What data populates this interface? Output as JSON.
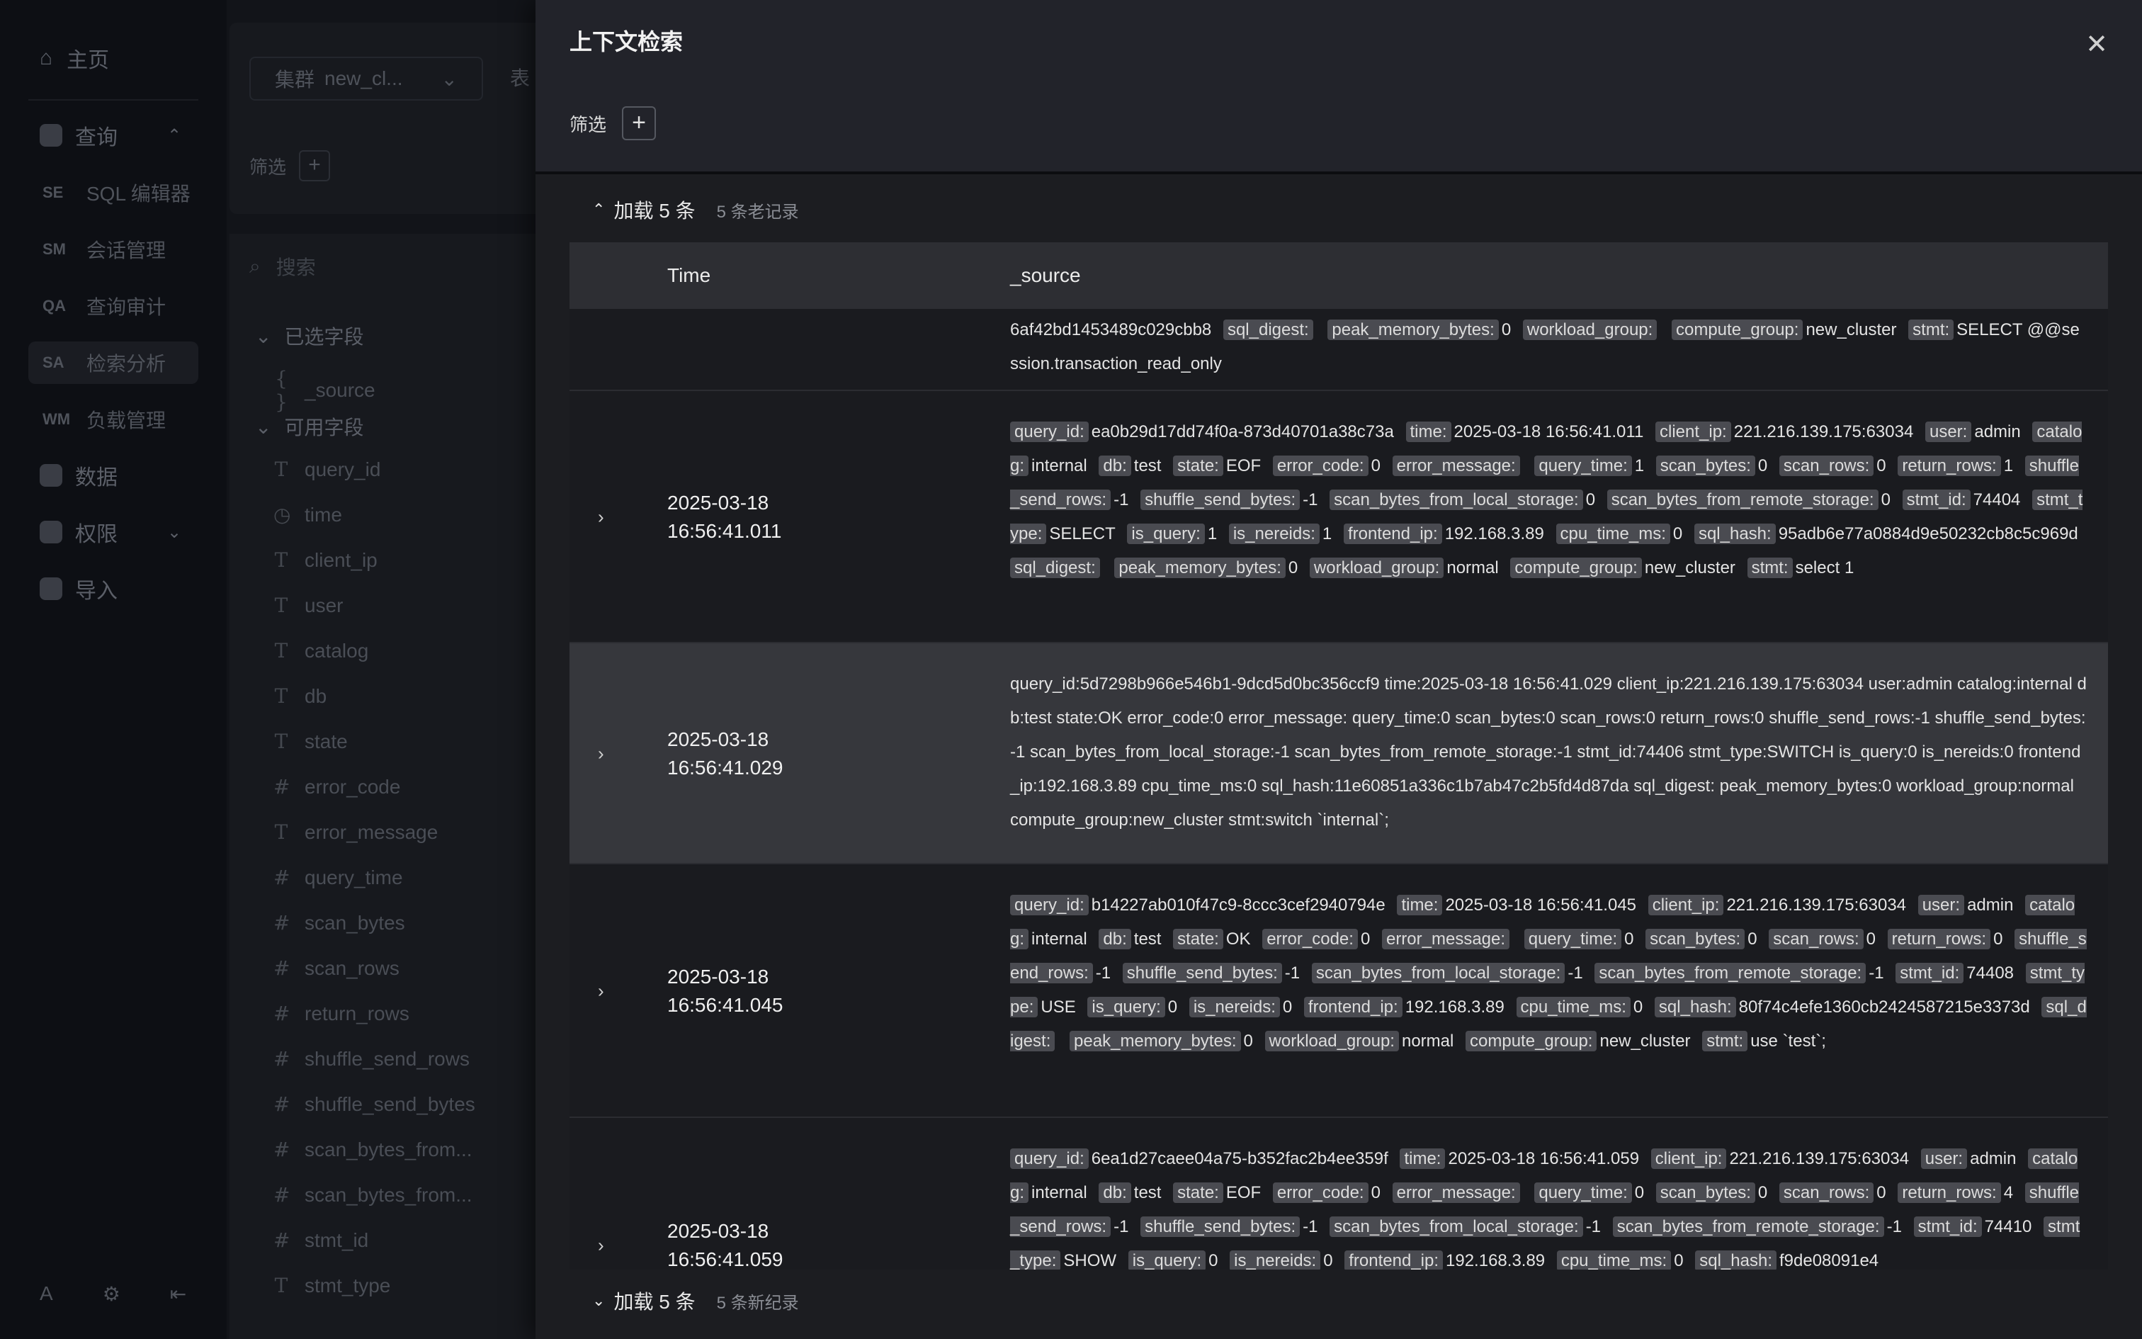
{
  "sidebar": {
    "home": "主页",
    "query_group": "查询",
    "items": [
      {
        "abbr": "SE",
        "label": "SQL 编辑器"
      },
      {
        "abbr": "SM",
        "label": "会话管理"
      },
      {
        "abbr": "QA",
        "label": "查询审计"
      },
      {
        "abbr": "SA",
        "label": "检索分析"
      },
      {
        "abbr": "WM",
        "label": "负载管理"
      }
    ],
    "data": "数据",
    "permissions": "权限",
    "import": "导入",
    "footer_avatar": "A"
  },
  "background": {
    "cluster_label": "集群",
    "cluster_value": "new_cl...",
    "table_label": "表",
    "filter_label": "筛选",
    "search_placeholder": "搜索",
    "selected_fields_label": "已选字段",
    "selected_fields": [
      "_source"
    ],
    "available_fields_label": "可用字段",
    "available_fields": [
      {
        "type": "T",
        "name": "query_id"
      },
      {
        "type": "◷",
        "name": "time"
      },
      {
        "type": "T",
        "name": "client_ip"
      },
      {
        "type": "T",
        "name": "user"
      },
      {
        "type": "T",
        "name": "catalog"
      },
      {
        "type": "T",
        "name": "db"
      },
      {
        "type": "T",
        "name": "state"
      },
      {
        "type": "#",
        "name": "error_code"
      },
      {
        "type": "T",
        "name": "error_message"
      },
      {
        "type": "#",
        "name": "query_time"
      },
      {
        "type": "#",
        "name": "scan_bytes"
      },
      {
        "type": "#",
        "name": "scan_rows"
      },
      {
        "type": "#",
        "name": "return_rows"
      },
      {
        "type": "#",
        "name": "shuffle_send_rows"
      },
      {
        "type": "#",
        "name": "shuffle_send_bytes"
      },
      {
        "type": "#",
        "name": "scan_bytes_from..."
      },
      {
        "type": "#",
        "name": "scan_bytes_from..."
      },
      {
        "type": "#",
        "name": "stmt_id"
      },
      {
        "type": "T",
        "name": "stmt_type"
      }
    ]
  },
  "drawer": {
    "title": "上下文检索",
    "filter_label": "筛选",
    "load_older_label": "加载 5 条",
    "older_count": "5 条老记录",
    "load_newer_label": "加载 5 条",
    "newer_count": "5 条新纪录",
    "columns": {
      "time": "Time",
      "source": "_source"
    }
  },
  "rows": [
    {
      "date": "",
      "clock": "",
      "plain": false,
      "partial": true,
      "fields": [
        {
          "k": "",
          "v": "6af42bd1453489c029cbb8"
        },
        {
          "k": "sql_digest:",
          "v": ""
        },
        {
          "k": "peak_memory_bytes:",
          "v": "0"
        },
        {
          "k": "workload_group:",
          "v": ""
        },
        {
          "k": "compute_group:",
          "v": "new_cluster"
        },
        {
          "k": "stmt:",
          "v": "SELECT @@session.transaction_read_only"
        }
      ]
    },
    {
      "date": "2025-03-18",
      "clock": "16:56:41.011",
      "plain": false,
      "fields": [
        {
          "k": "query_id:",
          "v": "ea0b29d17dd74f0a-873d40701a38c73a"
        },
        {
          "k": "time:",
          "v": "2025-03-18 16:56:41.011"
        },
        {
          "k": "client_ip:",
          "v": "221.216.139.175:63034"
        },
        {
          "k": "user:",
          "v": "admin"
        },
        {
          "k": "catalog:",
          "v": "internal"
        },
        {
          "k": "db:",
          "v": "test"
        },
        {
          "k": "state:",
          "v": "EOF"
        },
        {
          "k": "error_code:",
          "v": "0"
        },
        {
          "k": "error_message:",
          "v": ""
        },
        {
          "k": "query_time:",
          "v": "1"
        },
        {
          "k": "scan_bytes:",
          "v": "0"
        },
        {
          "k": "scan_rows:",
          "v": "0"
        },
        {
          "k": "return_rows:",
          "v": "1"
        },
        {
          "k": "shuffle_send_rows:",
          "v": "-1"
        },
        {
          "k": "shuffle_send_bytes:",
          "v": "-1"
        },
        {
          "k": "scan_bytes_from_local_storage:",
          "v": "0"
        },
        {
          "k": "scan_bytes_from_remote_storage:",
          "v": "0"
        },
        {
          "k": "stmt_id:",
          "v": "74404"
        },
        {
          "k": "stmt_type:",
          "v": "SELECT"
        },
        {
          "k": "is_query:",
          "v": "1"
        },
        {
          "k": "is_nereids:",
          "v": "1"
        },
        {
          "k": "frontend_ip:",
          "v": "192.168.3.89"
        },
        {
          "k": "cpu_time_ms:",
          "v": "0"
        },
        {
          "k": "sql_hash:",
          "v": "95adb6e77a0884d9e50232cb8c5c969d"
        },
        {
          "k": "sql_digest:",
          "v": ""
        },
        {
          "k": "peak_memory_bytes:",
          "v": "0"
        },
        {
          "k": "workload_group:",
          "v": "normal"
        },
        {
          "k": "compute_group:",
          "v": "new_cluster"
        },
        {
          "k": "stmt:",
          "v": "select 1"
        }
      ]
    },
    {
      "date": "2025-03-18",
      "clock": "16:56:41.029",
      "plain": true,
      "text": "query_id:5d7298b966e546b1-9dcd5d0bc356ccf9 time:2025-03-18 16:56:41.029 client_ip:221.216.139.175:63034 user:admin catalog:internal db:test state:OK error_code:0 error_message: query_time:0 scan_bytes:0 scan_rows:0 return_rows:0 shuffle_send_rows:-1 shuffle_send_bytes:-1 scan_bytes_from_local_storage:-1 scan_bytes_from_remote_storage:-1 stmt_id:74406 stmt_type:SWITCH is_query:0 is_nereids:0 frontend_ip:192.168.3.89 cpu_time_ms:0 sql_hash:11e60851a336c1b7ab47c2b5fd4d87da sql_digest: peak_memory_bytes:0 workload_group:normal compute_group:new_cluster stmt:switch `internal`;"
    },
    {
      "date": "2025-03-18",
      "clock": "16:56:41.045",
      "plain": false,
      "fields": [
        {
          "k": "query_id:",
          "v": "b14227ab010f47c9-8ccc3cef2940794e"
        },
        {
          "k": "time:",
          "v": "2025-03-18 16:56:41.045"
        },
        {
          "k": "client_ip:",
          "v": "221.216.139.175:63034"
        },
        {
          "k": "user:",
          "v": "admin"
        },
        {
          "k": "catalog:",
          "v": "internal"
        },
        {
          "k": "db:",
          "v": "test"
        },
        {
          "k": "state:",
          "v": "OK"
        },
        {
          "k": "error_code:",
          "v": "0"
        },
        {
          "k": "error_message:",
          "v": ""
        },
        {
          "k": "query_time:",
          "v": "0"
        },
        {
          "k": "scan_bytes:",
          "v": "0"
        },
        {
          "k": "scan_rows:",
          "v": "0"
        },
        {
          "k": "return_rows:",
          "v": "0"
        },
        {
          "k": "shuffle_send_rows:",
          "v": "-1"
        },
        {
          "k": "shuffle_send_bytes:",
          "v": "-1"
        },
        {
          "k": "scan_bytes_from_local_storage:",
          "v": "-1"
        },
        {
          "k": "scan_bytes_from_remote_storage:",
          "v": "-1"
        },
        {
          "k": "stmt_id:",
          "v": "74408"
        },
        {
          "k": "stmt_type:",
          "v": "USE"
        },
        {
          "k": "is_query:",
          "v": "0"
        },
        {
          "k": "is_nereids:",
          "v": "0"
        },
        {
          "k": "frontend_ip:",
          "v": "192.168.3.89"
        },
        {
          "k": "cpu_time_ms:",
          "v": "0"
        },
        {
          "k": "sql_hash:",
          "v": "80f74c4efe1360cb2424587215e3373d"
        },
        {
          "k": "sql_digest:",
          "v": ""
        },
        {
          "k": "peak_memory_bytes:",
          "v": "0"
        },
        {
          "k": "workload_group:",
          "v": "normal"
        },
        {
          "k": "compute_group:",
          "v": "new_cluster"
        },
        {
          "k": "stmt:",
          "v": "use `test`;"
        }
      ]
    },
    {
      "date": "2025-03-18",
      "clock": "16:56:41.059",
      "plain": false,
      "fields": [
        {
          "k": "query_id:",
          "v": "6ea1d27caee04a75-b352fac2b4ee359f"
        },
        {
          "k": "time:",
          "v": "2025-03-18 16:56:41.059"
        },
        {
          "k": "client_ip:",
          "v": "221.216.139.175:63034"
        },
        {
          "k": "user:",
          "v": "admin"
        },
        {
          "k": "catalog:",
          "v": "internal"
        },
        {
          "k": "db:",
          "v": "test"
        },
        {
          "k": "state:",
          "v": "EOF"
        },
        {
          "k": "error_code:",
          "v": "0"
        },
        {
          "k": "error_message:",
          "v": ""
        },
        {
          "k": "query_time:",
          "v": "0"
        },
        {
          "k": "scan_bytes:",
          "v": "0"
        },
        {
          "k": "scan_rows:",
          "v": "0"
        },
        {
          "k": "return_rows:",
          "v": "4"
        },
        {
          "k": "shuffle_send_rows:",
          "v": "-1"
        },
        {
          "k": "shuffle_send_bytes:",
          "v": "-1"
        },
        {
          "k": "scan_bytes_from_local_storage:",
          "v": "-1"
        },
        {
          "k": "scan_bytes_from_remote_storage:",
          "v": "-1"
        },
        {
          "k": "stmt_id:",
          "v": "74410"
        },
        {
          "k": "stmt_type:",
          "v": "SHOW"
        },
        {
          "k": "is_query:",
          "v": "0"
        },
        {
          "k": "is_nereids:",
          "v": "0"
        },
        {
          "k": "frontend_ip:",
          "v": "192.168.3.89"
        },
        {
          "k": "cpu_time_ms:",
          "v": "0"
        },
        {
          "k": "sql_hash:",
          "v": "f9de08091e4"
        }
      ]
    }
  ]
}
